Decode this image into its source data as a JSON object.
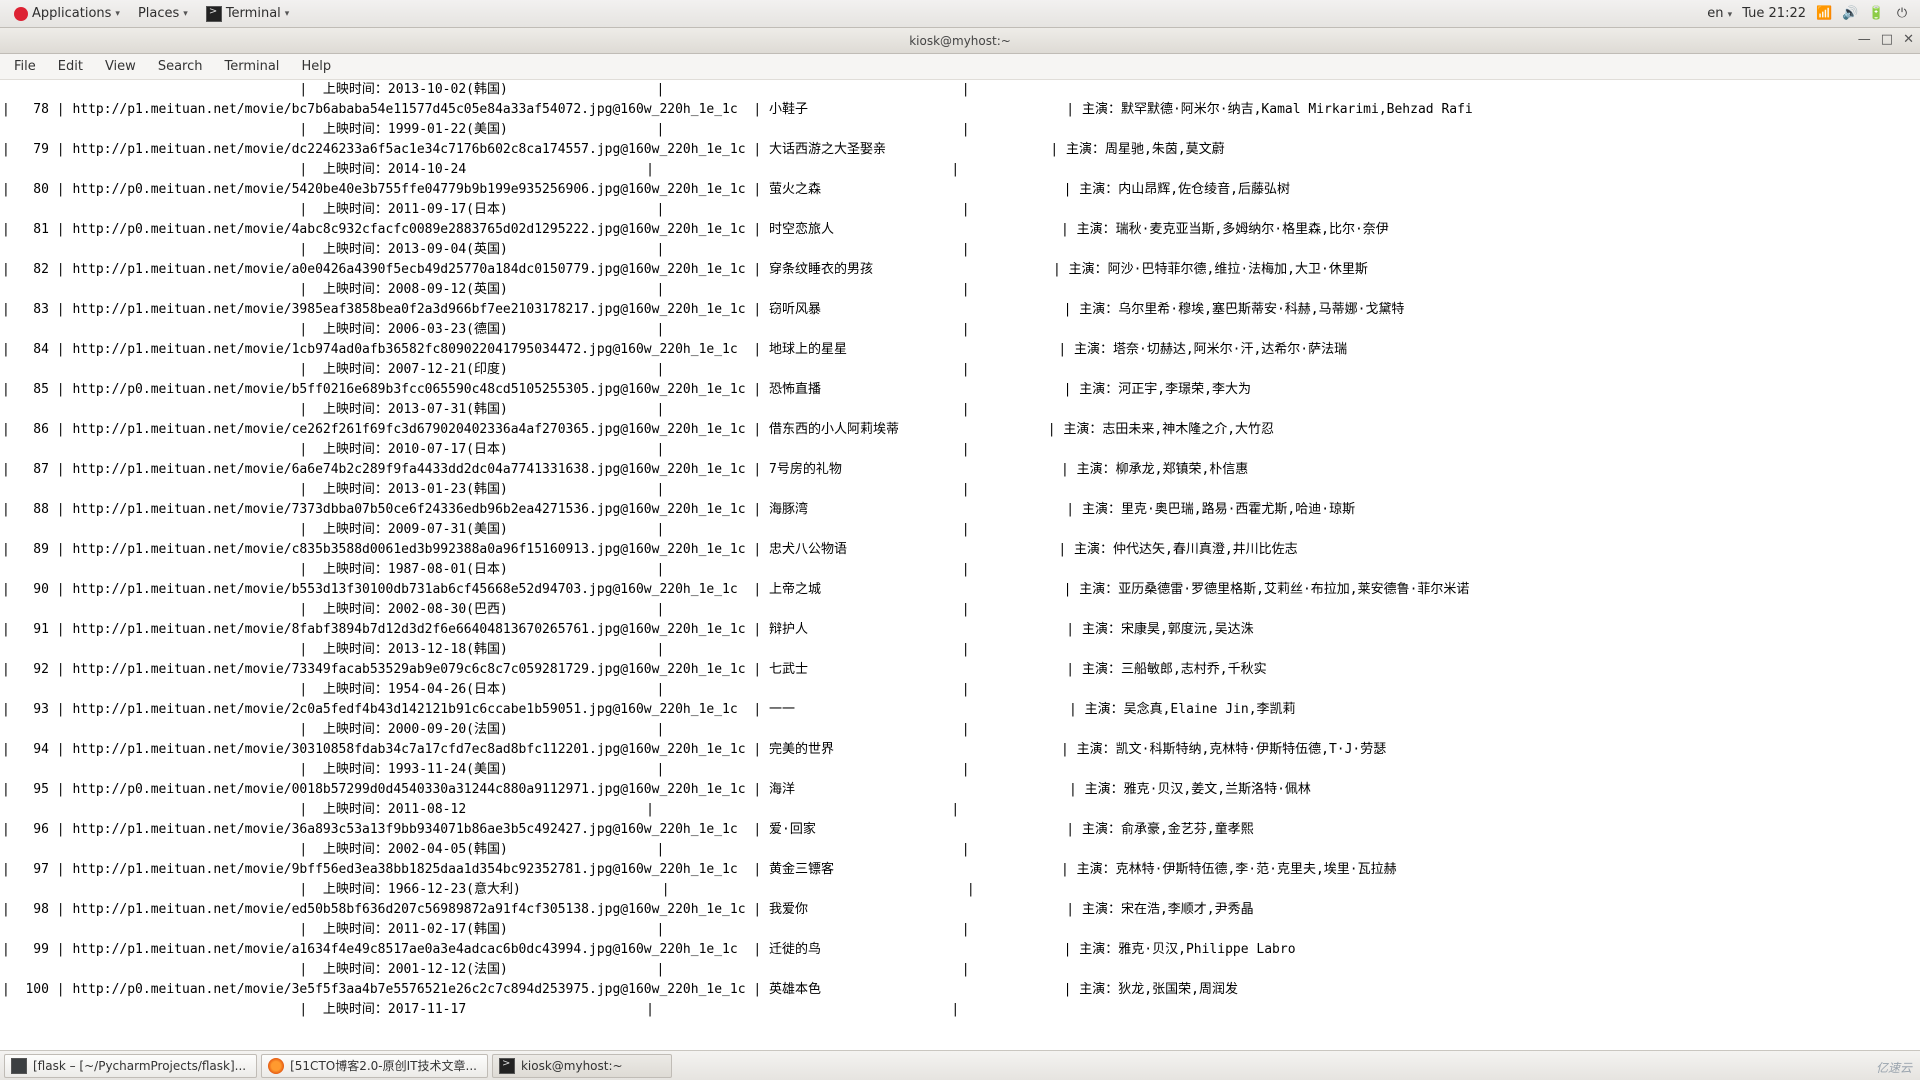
{
  "panel": {
    "applications": "Applications",
    "places": "Places",
    "terminal": "Terminal",
    "lang": "en",
    "clock": "Tue 21:22"
  },
  "window": {
    "title": "kiosk@myhost:~",
    "menus": [
      "File",
      "Edit",
      "View",
      "Search",
      "Terminal",
      "Help"
    ]
  },
  "taskbar": {
    "t1": "[flask – [~/PycharmProjects/flask]...",
    "t2": "[51CTO博客2.0-原创IT技术文章...",
    "t3": "kiosk@myhost:~"
  },
  "rows": [
    {
      "id": "",
      "url": "",
      "title": "",
      "cast": "",
      "rel": "上映时间：2013-10-02(韩国)"
    },
    {
      "id": "78",
      "url": "http://p1.meituan.net/movie/bc7b6ababa54e11577d45c05e84a33af54072.jpg@160w_220h_1e_1c",
      "title": "小鞋子",
      "cast": "主演：默罕默德·阿米尔·纳吉,Kamal Mirkarimi,Behzad Rafi",
      "rel": "上映时间：1999-01-22(美国)"
    },
    {
      "id": "79",
      "url": "http://p1.meituan.net/movie/dc2246233a6f5ac1e34c7176b602c8ca174557.jpg@160w_220h_1e_1c",
      "title": "大话西游之大圣娶亲",
      "cast": "主演：周星驰,朱茵,莫文蔚",
      "rel": "上映时间：2014-10-24"
    },
    {
      "id": "80",
      "url": "http://p0.meituan.net/movie/5420be40e3b755ffe04779b9b199e935256906.jpg@160w_220h_1e_1c",
      "title": "萤火之森",
      "cast": "主演：内山昂辉,佐仓绫音,后藤弘树",
      "rel": "上映时间：2011-09-17(日本)"
    },
    {
      "id": "81",
      "url": "http://p0.meituan.net/movie/4abc8c932cfacfc0089e2883765d02d1295222.jpg@160w_220h_1e_1c",
      "title": "时空恋旅人",
      "cast": "主演：瑞秋·麦克亚当斯,多姆纳尔·格里森,比尔·奈伊",
      "rel": "上映时间：2013-09-04(英国)"
    },
    {
      "id": "82",
      "url": "http://p1.meituan.net/movie/a0e0426a4390f5ecb49d25770a184dc0150779.jpg@160w_220h_1e_1c",
      "title": "穿条纹睡衣的男孩",
      "cast": "主演：阿沙·巴特菲尔德,维拉·法梅加,大卫·休里斯",
      "rel": "上映时间：2008-09-12(英国)"
    },
    {
      "id": "83",
      "url": "http://p1.meituan.net/movie/3985eaf3858bea0f2a3d966bf7ee2103178217.jpg@160w_220h_1e_1c",
      "title": "窃听风暴",
      "cast": "主演：乌尔里希·穆埃,塞巴斯蒂安·科赫,马蒂娜·戈黛特",
      "rel": "上映时间：2006-03-23(德国)"
    },
    {
      "id": "84",
      "url": "http://p1.meituan.net/movie/1cb974ad0afb36582fc809022041795034472.jpg@160w_220h_1e_1c",
      "title": "地球上的星星",
      "cast": "主演：塔奈·切赫达,阿米尔·汗,达希尔·萨法瑞",
      "rel": "上映时间：2007-12-21(印度)"
    },
    {
      "id": "85",
      "url": "http://p0.meituan.net/movie/b5ff0216e689b3fcc065590c48cd5105255305.jpg@160w_220h_1e_1c",
      "title": "恐怖直播",
      "cast": "主演：河正宇,李璟荣,李大为",
      "rel": "上映时间：2013-07-31(韩国)"
    },
    {
      "id": "86",
      "url": "http://p1.meituan.net/movie/ce262f261f69fc3d679020402336a4af270365.jpg@160w_220h_1e_1c",
      "title": "借东西的小人阿莉埃蒂",
      "cast": "主演：志田未来,神木隆之介,大竹忍",
      "rel": "上映时间：2010-07-17(日本)"
    },
    {
      "id": "87",
      "url": "http://p1.meituan.net/movie/6a6e74b2c289f9fa4433dd2dc04a7741331638.jpg@160w_220h_1e_1c",
      "title": "7号房的礼物",
      "cast": "主演：柳承龙,郑镇荣,朴信惠",
      "rel": "上映时间：2013-01-23(韩国)"
    },
    {
      "id": "88",
      "url": "http://p1.meituan.net/movie/7373dbba07b50ce6f24336edb96b2ea4271536.jpg@160w_220h_1e_1c",
      "title": "海豚湾",
      "cast": "主演：里克·奥巴瑞,路易·西霍尤斯,哈迪·琼斯",
      "rel": "上映时间：2009-07-31(美国)"
    },
    {
      "id": "89",
      "url": "http://p1.meituan.net/movie/c835b3588d0061ed3b992388a0a96f15160913.jpg@160w_220h_1e_1c",
      "title": "忠犬八公物语",
      "cast": "主演：仲代达矢,春川真澄,井川比佐志",
      "rel": "上映时间：1987-08-01(日本)"
    },
    {
      "id": "90",
      "url": "http://p1.meituan.net/movie/b553d13f30100db731ab6cf45668e52d94703.jpg@160w_220h_1e_1c",
      "title": "上帝之城",
      "cast": "主演：亚历桑德雷·罗德里格斯,艾莉丝·布拉加,莱安德鲁·菲尔米诺",
      "rel": "上映时间：2002-08-30(巴西)"
    },
    {
      "id": "91",
      "url": "http://p1.meituan.net/movie/8fabf3894b7d12d3d2f6e66404813670265761.jpg@160w_220h_1e_1c",
      "title": "辩护人",
      "cast": "主演：宋康昊,郭度沅,吴达洙",
      "rel": "上映时间：2013-12-18(韩国)"
    },
    {
      "id": "92",
      "url": "http://p1.meituan.net/movie/73349facab53529ab9e079c6c8c7c059281729.jpg@160w_220h_1e_1c",
      "title": "七武士",
      "cast": "主演：三船敏郎,志村乔,千秋实",
      "rel": "上映时间：1954-04-26(日本)"
    },
    {
      "id": "93",
      "url": "http://p1.meituan.net/movie/2c0a5fedf4b43d142121b91c6ccabe1b59051.jpg@160w_220h_1e_1c",
      "title": "一一",
      "cast": "主演：吴念真,Elaine Jin,李凯莉",
      "rel": "上映时间：2000-09-20(法国)"
    },
    {
      "id": "94",
      "url": "http://p1.meituan.net/movie/30310858fdab34c7a17cfd7ec8ad8bfc112201.jpg@160w_220h_1e_1c",
      "title": "完美的世界",
      "cast": "主演：凯文·科斯特纳,克林特·伊斯特伍德,T·J·劳瑟",
      "rel": "上映时间：1993-11-24(美国)"
    },
    {
      "id": "95",
      "url": "http://p0.meituan.net/movie/0018b57299d0d4540330a31244c880a9112971.jpg@160w_220h_1e_1c",
      "title": "海洋",
      "cast": "主演：雅克·贝汉,姜文,兰斯洛特·佩林",
      "rel": "上映时间：2011-08-12"
    },
    {
      "id": "96",
      "url": "http://p1.meituan.net/movie/36a893c53a13f9bb934071b86ae3b5c492427.jpg@160w_220h_1e_1c",
      "title": "爱·回家",
      "cast": "主演：俞承豪,金艺芬,童孝熙",
      "rel": "上映时间：2002-04-05(韩国)"
    },
    {
      "id": "97",
      "url": "http://p1.meituan.net/movie/9bff56ed3ea38bb1825daa1d354bc92352781.jpg@160w_220h_1e_1c",
      "title": "黄金三镖客",
      "cast": "主演：克林特·伊斯特伍德,李·范·克里夫,埃里·瓦拉赫",
      "rel": "上映时间：1966-12-23(意大利)"
    },
    {
      "id": "98",
      "url": "http://p1.meituan.net/movie/ed50b58bf636d207c56989872a91f4cf305138.jpg@160w_220h_1e_1c",
      "title": "我爱你",
      "cast": "主演：宋在浩,李顺才,尹秀晶",
      "rel": "上映时间：2011-02-17(韩国)"
    },
    {
      "id": "99",
      "url": "http://p1.meituan.net/movie/a1634f4e49c8517ae0a3e4adcac6b0dc43994.jpg@160w_220h_1e_1c",
      "title": "迁徙的鸟",
      "cast": "主演：雅克·贝汉,Philippe Labro",
      "rel": "上映时间：2001-12-12(法国)"
    },
    {
      "id": "100",
      "url": "http://p0.meituan.net/movie/3e5f5f3aa4b7e5576521e26c2c7c894d253975.jpg@160w_220h_1e_1c",
      "title": "英雄本色",
      "cast": "主演：狄龙,张国荣,周润发",
      "rel": "上映时间：2017-11-17"
    }
  ]
}
